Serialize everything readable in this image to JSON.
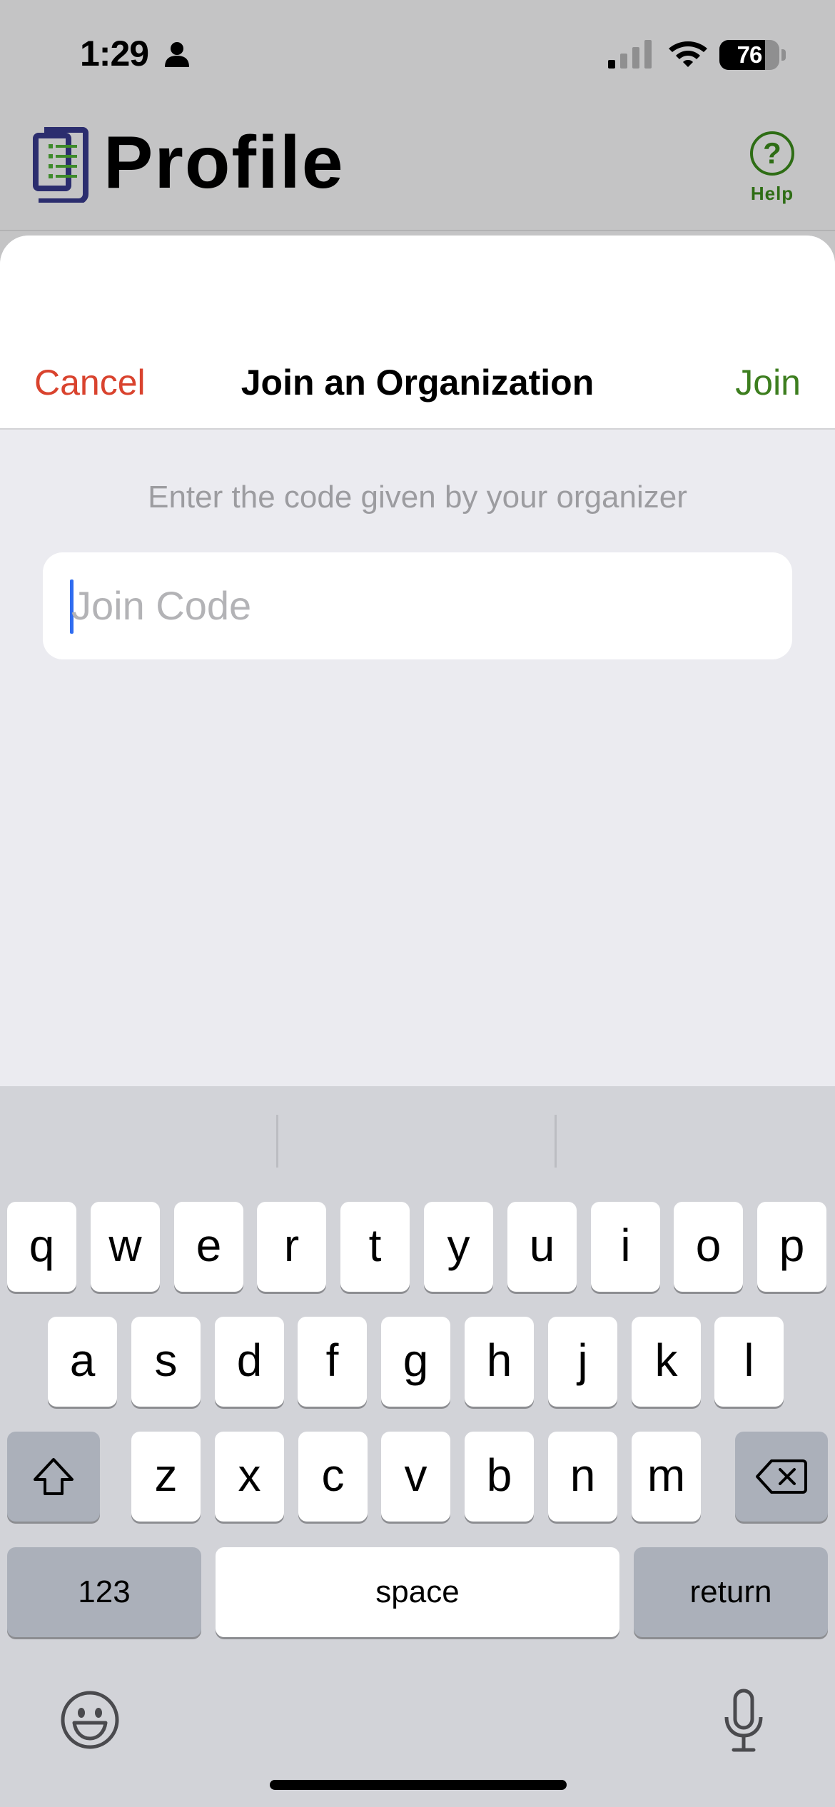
{
  "status_bar": {
    "time": "1:29",
    "battery_level": "76",
    "icons": [
      "person-icon",
      "cellular-signal-icon",
      "wifi-icon",
      "battery-icon"
    ]
  },
  "app_header": {
    "title": "Profile",
    "help_label": "Help",
    "help_glyph": "?",
    "logo_icon": "checklist-document-logo"
  },
  "sheet": {
    "cancel_label": "Cancel",
    "title": "Join an Organization",
    "join_label": "Join",
    "instructions": "Enter the code given by your organizer",
    "code_field": {
      "value": "",
      "placeholder": "Join Code"
    }
  },
  "keyboard": {
    "row1": [
      "q",
      "w",
      "e",
      "r",
      "t",
      "y",
      "u",
      "i",
      "o",
      "p"
    ],
    "row2": [
      "a",
      "s",
      "d",
      "f",
      "g",
      "h",
      "j",
      "k",
      "l"
    ],
    "row3": [
      "z",
      "x",
      "c",
      "v",
      "b",
      "n",
      "m"
    ],
    "numbers_label": "123",
    "space_label": "space",
    "return_label": "return",
    "icons": [
      "shift-icon",
      "backspace-icon",
      "emoji-icon",
      "microphone-icon"
    ]
  },
  "colors": {
    "cancel": "#d9432e",
    "join": "#3d7e1f",
    "help": "#2e6d15",
    "logo_navy": "#2b2d6e",
    "logo_green": "#3d8a2a",
    "caret": "#2f6cf0"
  }
}
